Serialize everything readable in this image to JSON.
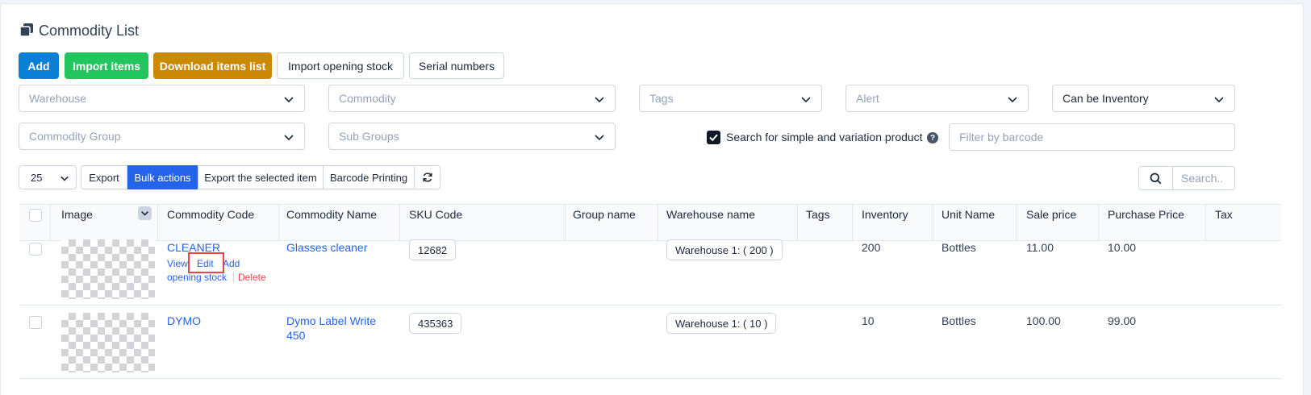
{
  "page": {
    "title": "Commodity List",
    "title_icon": "copy-icon"
  },
  "buttons": {
    "add": "Add",
    "import_items": "Import items",
    "download_items": "Download items list",
    "import_opening_stock": "Import opening stock",
    "serial_numbers": "Serial numbers"
  },
  "filters": {
    "warehouse": "Warehouse",
    "commodity": "Commodity",
    "tags": "Tags",
    "alert": "Alert",
    "can_be_inventory": "Can be Inventory",
    "commodity_group": "Commodity Group",
    "sub_groups": "Sub Groups",
    "search_variation_label": "Search for simple and variation product",
    "search_variation_checked": true,
    "barcode_placeholder": "Filter by barcode"
  },
  "toolbar": {
    "page_size": "25",
    "export": "Export",
    "bulk_actions": "Bulk actions",
    "export_selected": "Export the selected item",
    "barcode_printing": "Barcode Printing",
    "search_placeholder": "Search.."
  },
  "table": {
    "columns": [
      "Image",
      "Commodity Code",
      "Commodity Name",
      "SKU Code",
      "Group name",
      "Warehouse name",
      "Tags",
      "Inventory",
      "Unit Name",
      "Sale price",
      "Purchase Price",
      "Tax"
    ],
    "rows": [
      {
        "code": "CLEANER",
        "name": "Glasses cleaner",
        "sku": "12682",
        "group": "",
        "warehouse": "Warehouse 1: ( 200 )",
        "tags": "",
        "inventory": "200",
        "unit": "Bottles",
        "sale_price": "11.00",
        "purchase_price": "10.00",
        "actions": {
          "view": "View",
          "edit": "Edit",
          "add_opening_stock_1": "Add",
          "add_opening_stock_2": "opening stock",
          "delete": "Delete"
        }
      },
      {
        "code": "DYMO",
        "name_line1": "Dymo Label Write",
        "name_line2": "450",
        "sku": "435363",
        "group": "",
        "warehouse": "Warehouse 1: ( 10 )",
        "tags": "",
        "inventory": "10",
        "unit": "Bottles",
        "sale_price": "100.00",
        "purchase_price": "99.00"
      }
    ]
  },
  "colors": {
    "primary": "#0a7fd6",
    "success": "#22c55e",
    "warning": "#ca8a04",
    "link": "#2563eb",
    "danger": "#ef4444",
    "highlight": "#ef4444"
  }
}
